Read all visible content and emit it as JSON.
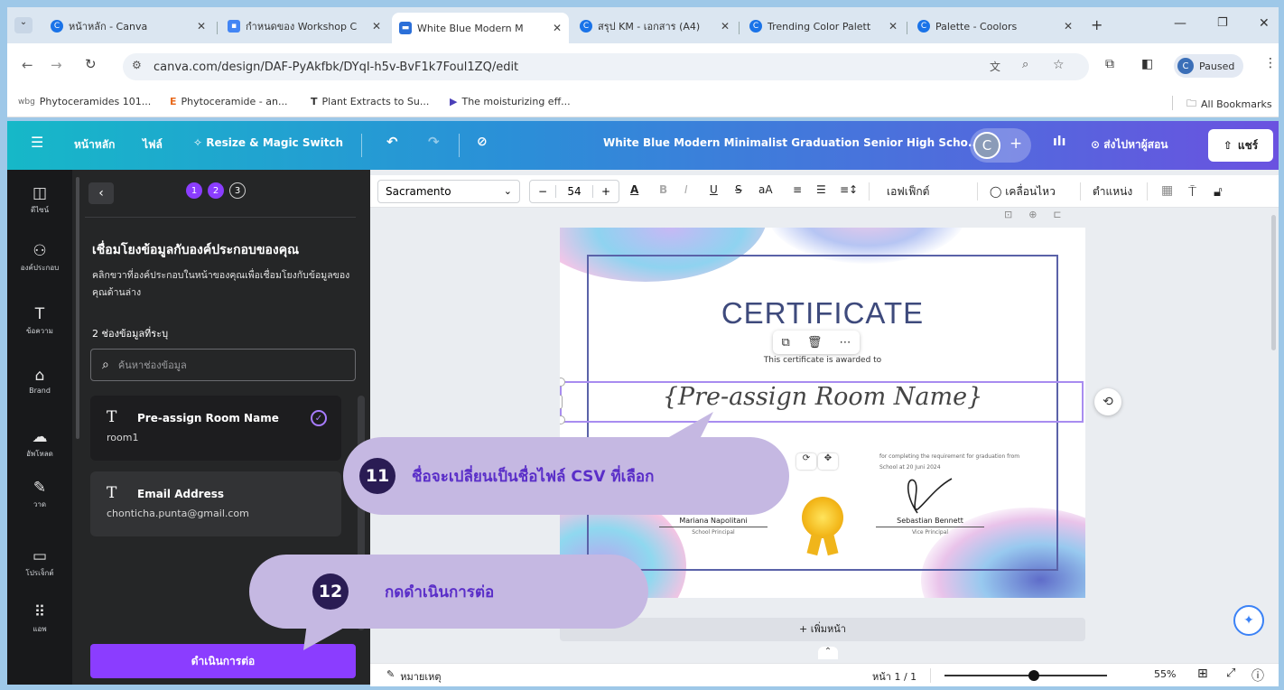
{
  "browser": {
    "tabs": [
      {
        "label": "หน้าหลัก - Canva"
      },
      {
        "label": "กำหนดของ Workshop C"
      },
      {
        "label": "White Blue Modern M"
      },
      {
        "label": "สรุป KM - เอกสาร (A4)"
      },
      {
        "label": "Trending Color Palett"
      },
      {
        "label": "Palette - Coolors"
      }
    ],
    "url": "canva.com/design/DAF-PyAkfbk/DYqI-h5v-BvF1k7Foul1ZQ/edit",
    "profile_status": "Paused",
    "bookmarks": [
      {
        "label": "Phytoceramides 101..."
      },
      {
        "label": "Phytoceramide - an..."
      },
      {
        "label": "Plant Extracts to Su..."
      },
      {
        "label": "The moisturizing eff..."
      }
    ],
    "all_bookmarks": "All Bookmarks"
  },
  "header": {
    "home": "หน้าหลัก",
    "file": "ไฟล์",
    "resize": "Resize & Magic Switch",
    "doc_title": "White Blue Modern Minimalist Graduation Senior High Scho...",
    "avatar_letter": "C",
    "send_teacher": "ส่งไปหาผู้สอน",
    "share": "แชร์"
  },
  "rail": [
    {
      "label": "ดีไซน์"
    },
    {
      "label": "องค์ประกอบ"
    },
    {
      "label": "ข้อความ"
    },
    {
      "label": "Brand"
    },
    {
      "label": "อัพโหลด"
    },
    {
      "label": "วาด"
    },
    {
      "label": "โปรเจ็กต์"
    },
    {
      "label": "แอพ"
    }
  ],
  "panel": {
    "steps": [
      "1",
      "2",
      "3"
    ],
    "heading": "เชื่อมโยงข้อมูลกับองค์ประกอบของคุณ",
    "description": "คลิกขวาที่องค์ประกอบในหน้าของคุณเพื่อเชื่อมโยงกับข้อมูลของคุณด้านล่าง",
    "field_count": "2 ช่องข้อมูลที่ระบุ",
    "search_placeholder": "ค้นหาช่องข้อมูล",
    "fields": [
      {
        "name": "Pre-assign Room Name",
        "value": "room1"
      },
      {
        "name": "Email Address",
        "value": "chonticha.punta@gmail.com"
      }
    ],
    "continue": "ดำเนินการต่อ"
  },
  "toolbar": {
    "font": "Sacramento",
    "font_size": "54",
    "effects": "เอฟเฟ็กต์",
    "animate": "เคลื่อนไหว",
    "position": "ตำแหน่ง"
  },
  "certificate": {
    "title": "CERTIFICATE",
    "awarded": "This certificate is awarded to",
    "name_placeholder": "{Pre-assign Room Name}",
    "body_line1": "for completing the requirement for graduation from",
    "body_line2": "School at 20 Juni 2024",
    "sig1_name": "Mariana Napolitani",
    "sig1_role": "School Principal",
    "sig2_name": "Sebastian Bennett",
    "sig2_role": "Vice Principal"
  },
  "add_page": "+ เพิ่มหน้า",
  "callouts": [
    {
      "num": "11",
      "text": "ชื่อจะเปลี่ยนเป็นชื่อไฟล์ CSV  ที่เลือก"
    },
    {
      "num": "12",
      "text": "กดดำเนินการต่อ"
    }
  ],
  "status": {
    "notes": "หมายเหตุ",
    "page": "หน้า 1 / 1",
    "zoom": "55%",
    "zoom_level": 0.55
  },
  "colors": {
    "accent": "#8b3dff",
    "callout_bg": "#c5b8e2",
    "callout_text": "#5a2ec8"
  }
}
